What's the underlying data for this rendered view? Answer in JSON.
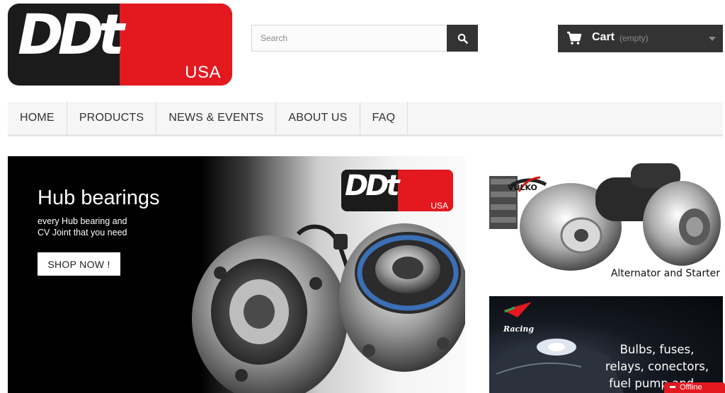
{
  "header": {
    "logo": {
      "mark": "DDt",
      "region": "USA"
    },
    "search": {
      "placeholder": "Search"
    },
    "cart": {
      "label": "Cart",
      "status": "(empty)"
    }
  },
  "nav": {
    "items": [
      "HOME",
      "PRODUCTS",
      "NEWS & EVENTS",
      "ABOUT US",
      "FAQ"
    ]
  },
  "slider": {
    "title": "Hub bearings",
    "subtitle_line1": "every Hub bearing and",
    "subtitle_line2": "CV Joint that you need",
    "button": "SHOP NOW !",
    "logo": {
      "mark": "DDt",
      "region": "USA"
    }
  },
  "side_banners": [
    {
      "caption": "Alternator and Starter",
      "brand": "VULKO"
    },
    {
      "brand": "Racing",
      "text_line1": "Bulbs, fuses,",
      "text_line2": "relays, conectors,",
      "text_line3": "fuel pump and..."
    }
  ],
  "chat": {
    "status": "Offline"
  },
  "colors": {
    "brand_red": "#e3191f",
    "dark": "#333333",
    "logo_black": "#1b1b1b"
  }
}
